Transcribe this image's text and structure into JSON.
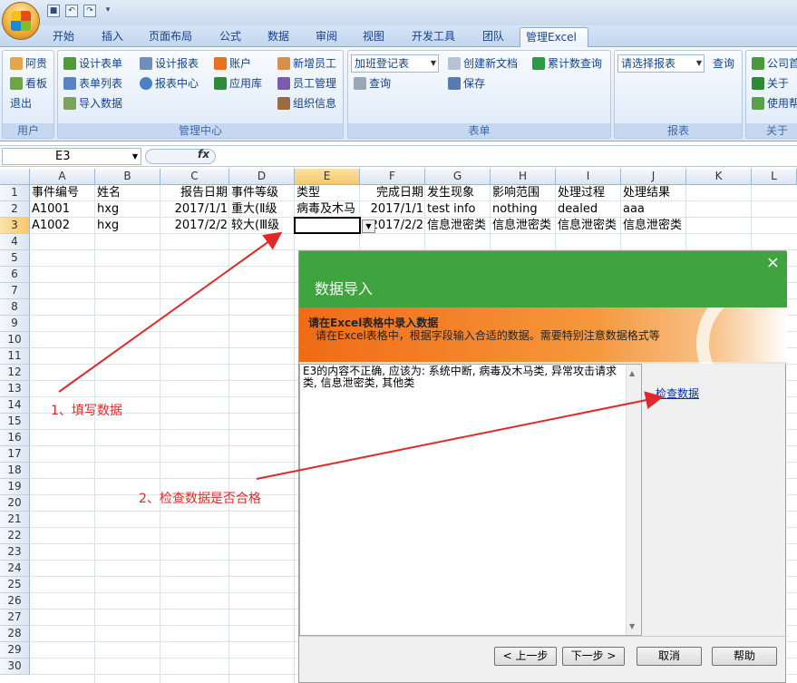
{
  "qat": {
    "save_icon": "save-icon",
    "undo_icon": "undo-icon",
    "redo_icon": "redo-icon",
    "customize_icon": "customize-icon"
  },
  "tabs": [
    {
      "label": "开始"
    },
    {
      "label": "插入"
    },
    {
      "label": "页面布局"
    },
    {
      "label": "公式"
    },
    {
      "label": "数据"
    },
    {
      "label": "审阅"
    },
    {
      "label": "视图"
    },
    {
      "label": "开发工具"
    },
    {
      "label": "团队"
    },
    {
      "label": "管理Excel"
    }
  ],
  "ribbon": {
    "user": {
      "label": "用户",
      "items": [
        "阿贵",
        "看板",
        "退出"
      ]
    },
    "manage": {
      "label": "管理中心",
      "items": [
        "设计表单",
        "表单列表",
        "导入数据",
        "设计报表",
        "报表中心",
        "账户",
        "应用库",
        "新增员工",
        "员工管理",
        "组织信息"
      ]
    },
    "form": {
      "label": "表单",
      "dropdown": "加班登记表",
      "query": "查询",
      "create_doc": "创建新文档",
      "save": "保存",
      "cumulative": "累计数查询"
    },
    "report": {
      "label": "报表",
      "dropdown": "请选择报表",
      "query": "查询"
    },
    "about": {
      "label": "关于",
      "items": [
        "公司首",
        "关于",
        "使用帮"
      ]
    }
  },
  "formula_bar": {
    "name_box": "E3",
    "fx": "fx",
    "value": ""
  },
  "columns": [
    "A",
    "B",
    "C",
    "D",
    "E",
    "F",
    "G",
    "H",
    "I",
    "J",
    "K",
    "L"
  ],
  "rows": [
    "1",
    "2",
    "3",
    "4",
    "5",
    "6",
    "7",
    "8",
    "9",
    "10",
    "11",
    "12",
    "13",
    "14",
    "15",
    "16",
    "17",
    "18",
    "19",
    "20",
    "21",
    "22",
    "23",
    "24",
    "25",
    "26",
    "27",
    "28",
    "29",
    "30"
  ],
  "cells": {
    "r1": [
      "事件编号",
      "姓名",
      "报告日期",
      "事件等级",
      "类型",
      "完成日期",
      "发生现象",
      "影响范围",
      "处理过程",
      "处理结果"
    ],
    "r2": [
      "A1001",
      "hxg",
      "2017/1/1",
      "重大(Ⅱ级",
      "病毒及木马",
      "2017/1/1",
      "test info",
      "nothing",
      "dealed",
      "aaa"
    ],
    "r3": [
      "A1002",
      "hxg",
      "2017/2/2",
      "较大(Ⅲ级",
      "",
      "2017/2/2",
      "信息泄密类",
      "信息泄密类",
      "信息泄密类",
      "信息泄密类"
    ]
  },
  "dialog": {
    "title": "数据导入",
    "banner_title": "请在Excel表格中录入数据",
    "banner_sub": "请在Excel表格中，根据字段输入合适的数据。需要特别注意数据格式等",
    "message": "E3的内容不正确, 应该为: 系统中断, 病毒及木马类, 异常攻击请求类, 信息泄密类, 其他类",
    "check_link": "检查数据",
    "buttons": {
      "prev": "< 上一步",
      "next": "下一步 >",
      "cancel": "取消",
      "help": "帮助"
    }
  },
  "annotations": {
    "step1": "1、填写数据",
    "step2": "2、检查数据是否合格"
  },
  "colors": {
    "dialog_green": "#3fa33f",
    "banner_orange": "#f06b16",
    "annotation_red": "#e02a2a",
    "link_blue": "#0033aa"
  }
}
